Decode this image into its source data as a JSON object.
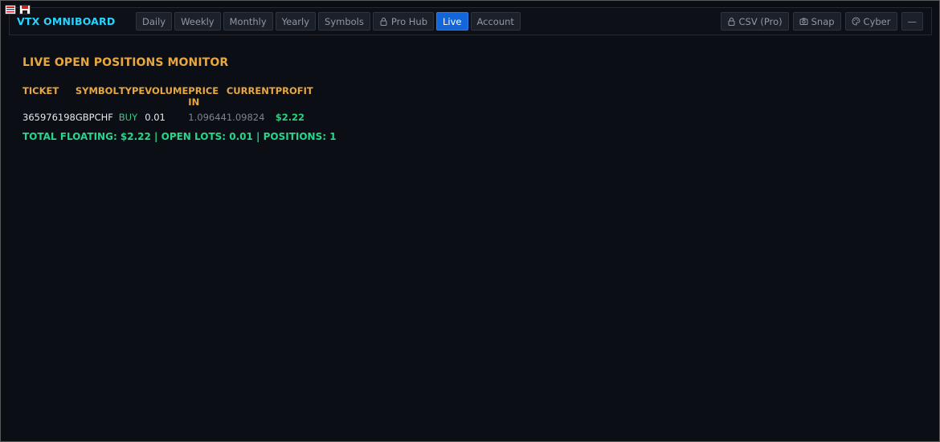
{
  "app": {
    "title": "VTX OMNIBOARD"
  },
  "nav": {
    "tabs": [
      {
        "label": "Daily",
        "active": false
      },
      {
        "label": "Weekly",
        "active": false
      },
      {
        "label": "Monthly",
        "active": false
      },
      {
        "label": "Yearly",
        "active": false
      },
      {
        "label": "Symbols",
        "active": false
      },
      {
        "label": "Pro Hub",
        "icon": "lock-icon",
        "active": false
      },
      {
        "label": "Live",
        "active": true
      },
      {
        "label": "Account",
        "active": false
      }
    ]
  },
  "toolbar": {
    "csv_label": "CSV (Pro)",
    "csv_icon": "lock-icon",
    "snap_label": "Snap",
    "snap_icon": "camera-icon",
    "cyber_label": "Cyber",
    "cyber_icon": "palette-icon",
    "minimize_label": "—"
  },
  "monitor": {
    "title": "LIVE OPEN POSITIONS MONITOR",
    "columns": [
      "TICKET",
      "SYMBOL",
      "TYPE",
      "VOLUME",
      "PRICE IN",
      "CURRENT",
      "PROFIT"
    ],
    "rows": [
      {
        "ticket": "365976198",
        "symbol": "GBPCHF",
        "type": "BUY",
        "volume": "0.01",
        "price_in": "1.09644",
        "current": "1.09824",
        "profit": "$2.22"
      }
    ],
    "summary": "TOTAL FLOATING: $2.22 | OPEN LOTS: 0.01 | POSITIONS: 1"
  },
  "colors": {
    "background": "#0b0e14",
    "brand": "#27d3ff",
    "header": "#e8a740",
    "positive": "#2ecf7e",
    "active_tab": "#1366d9"
  }
}
